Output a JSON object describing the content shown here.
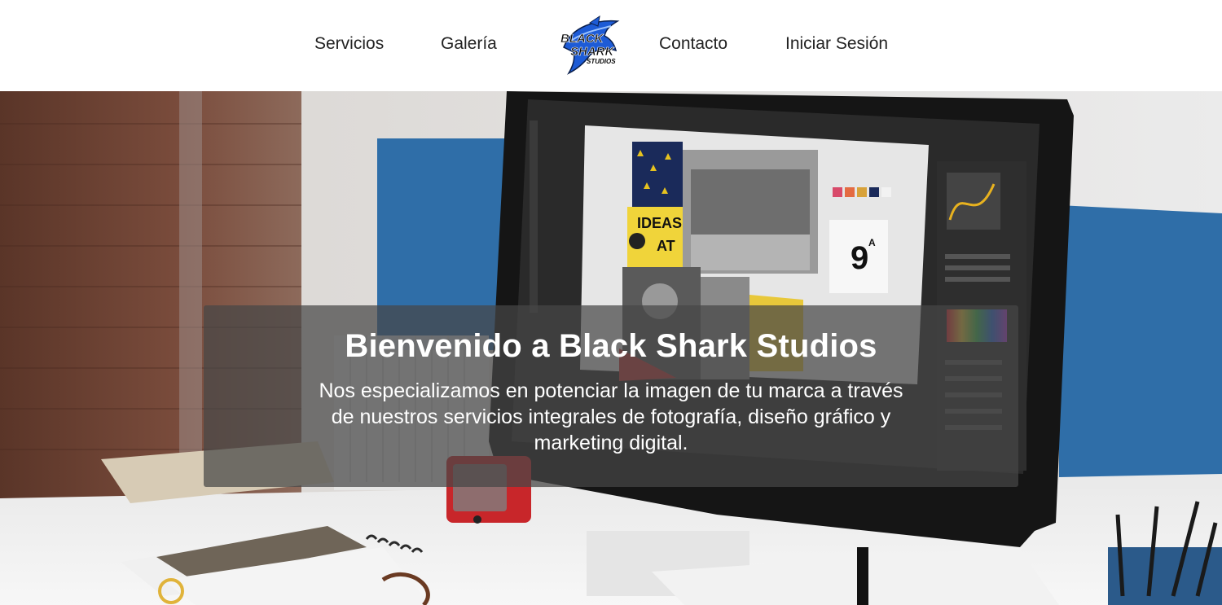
{
  "nav": {
    "items": [
      {
        "label": "Servicios"
      },
      {
        "label": "Galería"
      },
      {
        "label": "Contacto"
      },
      {
        "label": "Iniciar Sesión"
      }
    ],
    "logo": {
      "line1": "BLACK",
      "line2": "SHARK",
      "line3": "STUDIOS"
    }
  },
  "hero": {
    "title": "Bienvenido a Black Shark Studios",
    "subtitle": "Nos especializamos en potenciar la imagen de tu marca a través de nuestros servicios integrales de fotografía, diseño gráfico y marketing digital.",
    "screen": {
      "ideas_text": "IDEAS",
      "at_text": "AT",
      "page_number": "9",
      "page_letter": "A"
    }
  },
  "colors": {
    "logo_blue": "#1d5bd6",
    "overlay": "#464646",
    "wall_blue": "#2f6ea8",
    "brick": "#6e4638"
  }
}
